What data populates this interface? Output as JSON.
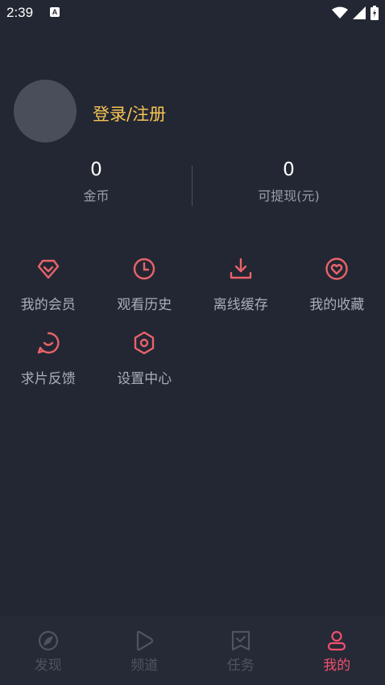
{
  "status_bar": {
    "time": "2:39",
    "app_badge": "A",
    "icons": [
      "wifi-icon",
      "signal-icon",
      "battery-icon"
    ]
  },
  "profile": {
    "login_text": "登录/注册"
  },
  "stats": {
    "coins": {
      "value": "0",
      "label": "金币"
    },
    "withdrawable": {
      "value": "0",
      "label": "可提现(元)"
    }
  },
  "features": [
    {
      "label": "我的会员",
      "icon": "vip-diamond-icon"
    },
    {
      "label": "观看历史",
      "icon": "clock-icon"
    },
    {
      "label": "离线缓存",
      "icon": "download-icon"
    },
    {
      "label": "我的收藏",
      "icon": "heart-icon"
    },
    {
      "label": "求片反馈",
      "icon": "feedback-bubble-icon"
    },
    {
      "label": "设置中心",
      "icon": "settings-hexagon-icon"
    }
  ],
  "bottom_nav": [
    {
      "label": "发现",
      "icon": "compass-icon",
      "active": false
    },
    {
      "label": "频道",
      "icon": "play-icon",
      "active": false
    },
    {
      "label": "任务",
      "icon": "task-icon",
      "active": false
    },
    {
      "label": "我的",
      "icon": "user-icon",
      "active": true
    }
  ],
  "colors": {
    "background": "#232733",
    "accent": "#f0506e",
    "icon_accent": "#e8636a",
    "login_text": "#f6c453",
    "muted_text": "#9a9eaa",
    "inactive_nav": "#4f5462"
  }
}
